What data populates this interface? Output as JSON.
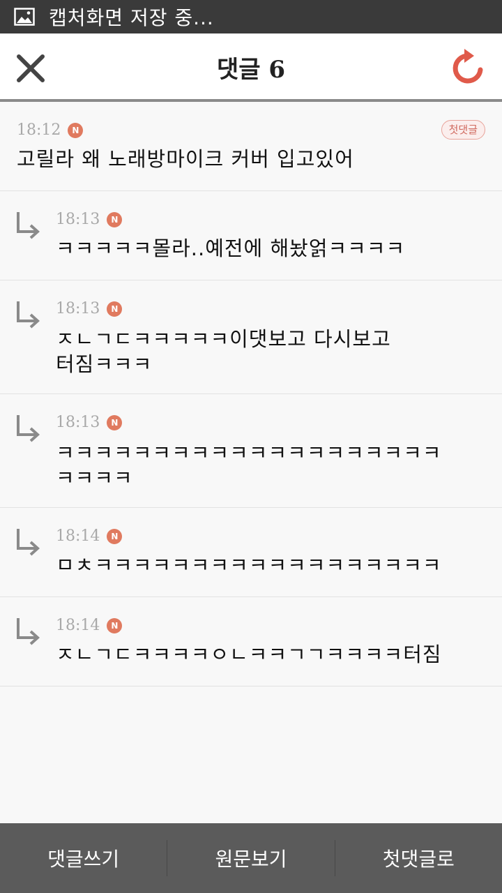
{
  "status_bar": {
    "text": "캡처화면 저장 중..."
  },
  "header": {
    "title": "댓글 6"
  },
  "comments": [
    {
      "time": "18:12",
      "badge": "N",
      "tag": "첫댓글",
      "text": "고릴라 왜 노래방마이크 커버 입고있어"
    },
    {
      "time": "18:13",
      "badge": "N",
      "text": "ㅋㅋㅋㅋㅋ몰라..예전에 해놨얽ㅋㅋㅋㅋ"
    },
    {
      "time": "18:13",
      "badge": "N",
      "text": "ㅈㄴㄱㄷㅋㅋㅋㅋㅋ이댓보고 다시보고\n터짐ㅋㅋㅋ"
    },
    {
      "time": "18:13",
      "badge": "N",
      "text": "ㅋㅋㅋㅋㅋㅋㅋㅋㅋㅋㅋㅋㅋㅋㅋㅋㅋㅋㅋㅋ\nㅋㅋㅋㅋ"
    },
    {
      "time": "18:14",
      "badge": "N",
      "text": "ㅁㅊㅋㅋㅋㅋㅋㅋㅋㅋㅋㅋㅋㅋㅋㅋㅋㅋㅋㅋ"
    },
    {
      "time": "18:14",
      "badge": "N",
      "text": "ㅈㄴㄱㄷㅋㅋㅋㅋㅇㄴㅋㅋㄱㄱㅋㅋㅋㅋ터짐"
    }
  ],
  "bottom_bar": {
    "write_label": "댓글쓰기",
    "original_label": "원문보기",
    "first_label": "첫댓글로"
  },
  "colors": {
    "accent": "#e05a4a",
    "badge": "#e07a5f",
    "status_bar": "#3a3a3a",
    "bottom_bar": "#5b5b5b"
  },
  "icons": {
    "close": "close-icon",
    "refresh": "refresh-icon",
    "reply": "reply-arrow-icon",
    "image": "image-icon"
  }
}
